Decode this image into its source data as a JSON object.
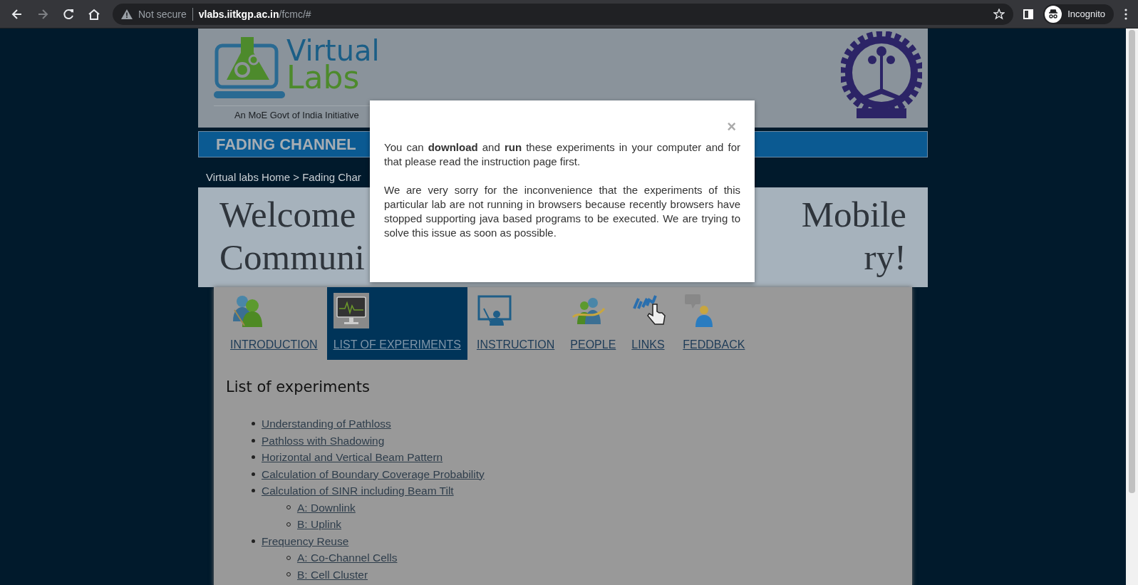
{
  "browser": {
    "nav": [
      {
        "kind": "back",
        "disabled": false
      },
      {
        "kind": "forward",
        "disabled": true
      },
      {
        "kind": "reload",
        "disabled": false
      },
      {
        "kind": "home",
        "disabled": false
      }
    ],
    "security": "Not secure",
    "url_host": "vlabs.iitkgp.ac.in",
    "url_path": "/fcmc/#",
    "profile": "Incognito"
  },
  "header": {
    "logo_top": "Virtual",
    "logo_bottom": "Labs",
    "tagline": "An MoE Govt of India Initiative"
  },
  "banner": "FADING CHANNEL",
  "breadcrumb": "Virtual labs Home > Fading Char",
  "heading": [
    {
      "left": "Welcome",
      "right": "Mobile"
    },
    {
      "left": "Communi",
      "right": "ry!"
    }
  ],
  "tabs": [
    {
      "label": "INTRODUCTION",
      "selected": false
    },
    {
      "label": "LIST OF EXPERIMENTS",
      "selected": true
    },
    {
      "label": "INSTRUCTION",
      "selected": false
    },
    {
      "label": "PEOPLE",
      "selected": false
    },
    {
      "label": "LINKS",
      "selected": false
    },
    {
      "label": "FEDDBACK",
      "selected": false
    }
  ],
  "list_title": "List of experiments",
  "experiments": [
    {
      "label": "Understanding of Pathloss"
    },
    {
      "label": "Pathloss with Shadowing"
    },
    {
      "label": "Horizontal and Vertical Beam Pattern"
    },
    {
      "label": "Calculation of Boundary Coverage Probability"
    },
    {
      "label": "Calculation of SINR including Beam Tilt",
      "children": [
        {
          "label": "A: Downlink"
        },
        {
          "label": "B: Uplink"
        }
      ]
    },
    {
      "label": "Frequency Reuse",
      "children": [
        {
          "label": "A: Co-Channel Cells"
        },
        {
          "label": "B: Cell Cluster"
        }
      ]
    }
  ],
  "modal": {
    "close": "×",
    "paragraphs": [
      "You can **download** and **run** these experiments in your computer and for that please read the instruction page first.",
      "We are very sorry for the inconvenience that the experiments of this particular lab are not running in browsers because recently browsers have stopped supporting java based programs to be executed. We are trying to solve this issue as soon as possible."
    ]
  }
}
